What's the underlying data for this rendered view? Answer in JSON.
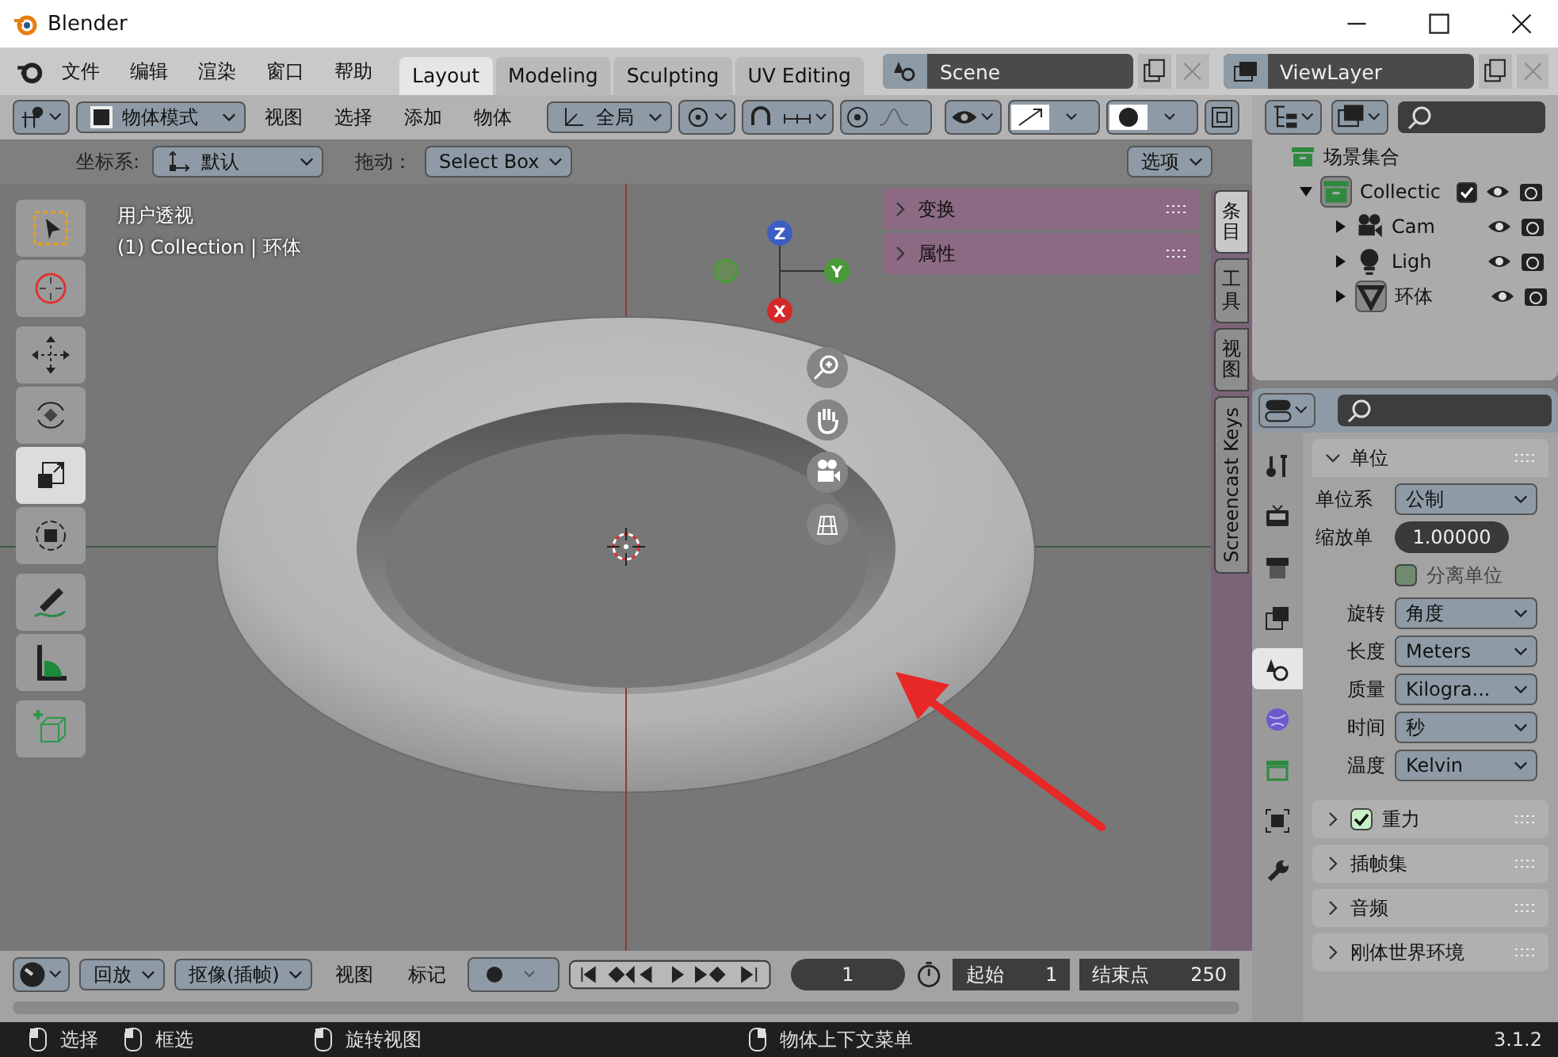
{
  "window": {
    "title": "Blender"
  },
  "menu": [
    "文件",
    "编辑",
    "渲染",
    "窗口",
    "帮助"
  ],
  "workspace_tabs": [
    {
      "label": "Layout",
      "selected": true
    },
    {
      "label": "Modeling",
      "selected": false
    },
    {
      "label": "Sculpting",
      "selected": false
    },
    {
      "label": "UV Editing",
      "selected": false
    }
  ],
  "scene": {
    "name": "Scene"
  },
  "view_layer": {
    "name": "ViewLayer"
  },
  "viewport_header": {
    "mode": "物体模式",
    "menus": [
      "视图",
      "选择",
      "添加",
      "物体"
    ],
    "orientation": "全局"
  },
  "tool_settings": {
    "orientation_label": "坐标系:",
    "orientation": "默认",
    "drag_label": "拖动：",
    "drag": "Select Box",
    "options": "选项"
  },
  "viewport": {
    "view_name": "用户透视",
    "object_info": "(1) Collection | 环体",
    "tool_groups": [
      [
        {
          "kind": "select",
          "selected": false
        },
        {
          "kind": "cursor",
          "selected": false
        }
      ],
      [
        {
          "kind": "move",
          "selected": false
        },
        {
          "kind": "rotate",
          "selected": false
        },
        {
          "kind": "scale",
          "selected": true
        },
        {
          "kind": "transform",
          "selected": false
        }
      ],
      [
        {
          "kind": "annotate",
          "selected": false
        },
        {
          "kind": "measure",
          "selected": false
        }
      ],
      [
        {
          "kind": "add-cube",
          "selected": false
        }
      ]
    ],
    "gizmo_axes": [
      "Z",
      "Y",
      "X"
    ],
    "panels": [
      "变换",
      "属性"
    ],
    "sidebar_tabs": [
      {
        "label": "条目",
        "selected": true,
        "kind": "stacked"
      },
      {
        "label": "工具",
        "selected": false,
        "kind": "stacked"
      },
      {
        "label": "视图",
        "selected": false,
        "kind": "stacked"
      },
      {
        "label": "Screencast Keys",
        "selected": false,
        "kind": "rotated"
      }
    ]
  },
  "outliner": {
    "items": [
      {
        "label": "场景集合",
        "kind": "scene-collection",
        "children": [
          {
            "label": "Collectic",
            "kind": "collection",
            "expanded": true,
            "checked": true,
            "children": [
              {
                "label": "Cam",
                "kind": "camera",
                "expanded": false
              },
              {
                "label": "Ligh",
                "kind": "light",
                "expanded": false
              },
              {
                "label": "环体",
                "kind": "mesh",
                "expanded": false
              }
            ]
          }
        ]
      }
    ]
  },
  "properties": {
    "tabs": [
      {
        "kind": "tool",
        "selected": false
      },
      {
        "kind": "render",
        "selected": false
      },
      {
        "kind": "output",
        "selected": false
      },
      {
        "kind": "view-layer",
        "selected": false
      },
      {
        "kind": "scene",
        "selected": true
      },
      {
        "kind": "world",
        "selected": false
      },
      {
        "kind": "collection",
        "selected": false
      },
      {
        "kind": "object",
        "selected": false
      },
      {
        "kind": "modifier",
        "selected": false
      }
    ],
    "units_panel": {
      "title": "单位",
      "expanded": true,
      "rows": [
        {
          "kind": "dropdown",
          "label": "单位系",
          "value": "公制"
        },
        {
          "kind": "number",
          "label": "缩放单",
          "value": "1.00000"
        },
        {
          "kind": "checkbox",
          "label": "分离单位",
          "checked": false
        },
        {
          "kind": "dropdown",
          "label": "旋转",
          "value": "角度"
        },
        {
          "kind": "dropdown",
          "label": "长度",
          "value": "Meters"
        },
        {
          "kind": "dropdown",
          "label": "质量",
          "value": "Kilogra..."
        },
        {
          "kind": "dropdown",
          "label": "时间",
          "value": "秒"
        },
        {
          "kind": "dropdown",
          "label": "温度",
          "value": "Kelvin"
        }
      ]
    },
    "collapsed_panels": [
      {
        "title": "重力",
        "kind": "toggle",
        "checked": true
      },
      {
        "title": "插帧集",
        "kind": "plain"
      },
      {
        "title": "音频",
        "kind": "plain"
      },
      {
        "title": "刚体世界环境",
        "kind": "plain"
      }
    ]
  },
  "timeline": {
    "playback": "回放",
    "keying": "抠像(插帧)",
    "menus": [
      "视图",
      "标记"
    ],
    "current_frame": "1",
    "start_label": "起始",
    "start": "1",
    "end_label": "结束点",
    "end": "250"
  },
  "status_bar": {
    "hints": [
      "选择",
      "框选",
      "旋转视图",
      "物体上下文菜单"
    ],
    "version": "3.1.2"
  }
}
